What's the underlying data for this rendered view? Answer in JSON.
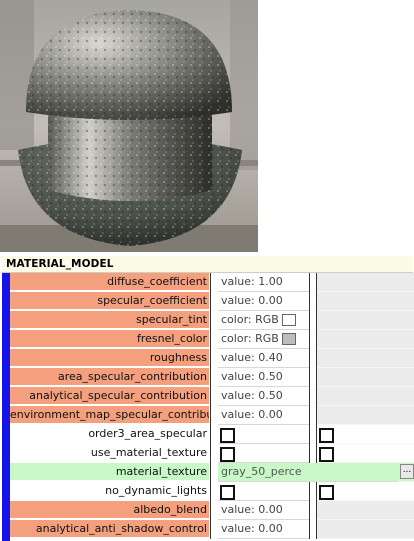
{
  "preview": {
    "icon": "material-sphere-preview"
  },
  "section": {
    "title": "MATERIAL_MODEL"
  },
  "params": [
    {
      "name": "diffuse_coefficient",
      "value": "value: 1.00",
      "color": "orange",
      "kind": "value"
    },
    {
      "name": "specular_coefficient",
      "value": "value: 0.00",
      "color": "orange",
      "kind": "value"
    },
    {
      "name": "specular_tint",
      "value": "color: RGB",
      "color": "orange",
      "kind": "color",
      "swatch": "#ffffff"
    },
    {
      "name": "fresnel_color",
      "value": "color: RGB",
      "color": "orange",
      "kind": "color",
      "swatch": "#bdbdbd"
    },
    {
      "name": "roughness",
      "value": "value: 0.40",
      "color": "orange",
      "kind": "value"
    },
    {
      "name": "area_specular_contribution",
      "value": "value: 0.50",
      "color": "orange",
      "kind": "value"
    },
    {
      "name": "analytical_specular_contribution",
      "value": "value: 0.50",
      "color": "orange",
      "kind": "value"
    },
    {
      "name": "environment_map_specular_contribution",
      "value": "value: 0.00",
      "color": "orange",
      "kind": "value"
    },
    {
      "name": "order3_area_specular",
      "value": "",
      "color": "white",
      "kind": "checkbox"
    },
    {
      "name": "use_material_texture",
      "value": "",
      "color": "white",
      "kind": "checkbox"
    },
    {
      "name": "material_texture",
      "value": "gray_50_perce",
      "color": "green",
      "kind": "texture"
    },
    {
      "name": "no_dynamic_lights",
      "value": "",
      "color": "white",
      "kind": "checkbox"
    },
    {
      "name": "albedo_blend",
      "value": "value: 0.00",
      "color": "orange",
      "kind": "value"
    },
    {
      "name": "analytical_anti_shadow_control",
      "value": "value: 0.00",
      "color": "orange",
      "kind": "value"
    }
  ],
  "browse_button_label": "...",
  "colors": {
    "orange": "#f4a07e",
    "green": "#c8f8c8",
    "accent_bar": "#1414e8",
    "header_bg": "#fbfbe8"
  }
}
